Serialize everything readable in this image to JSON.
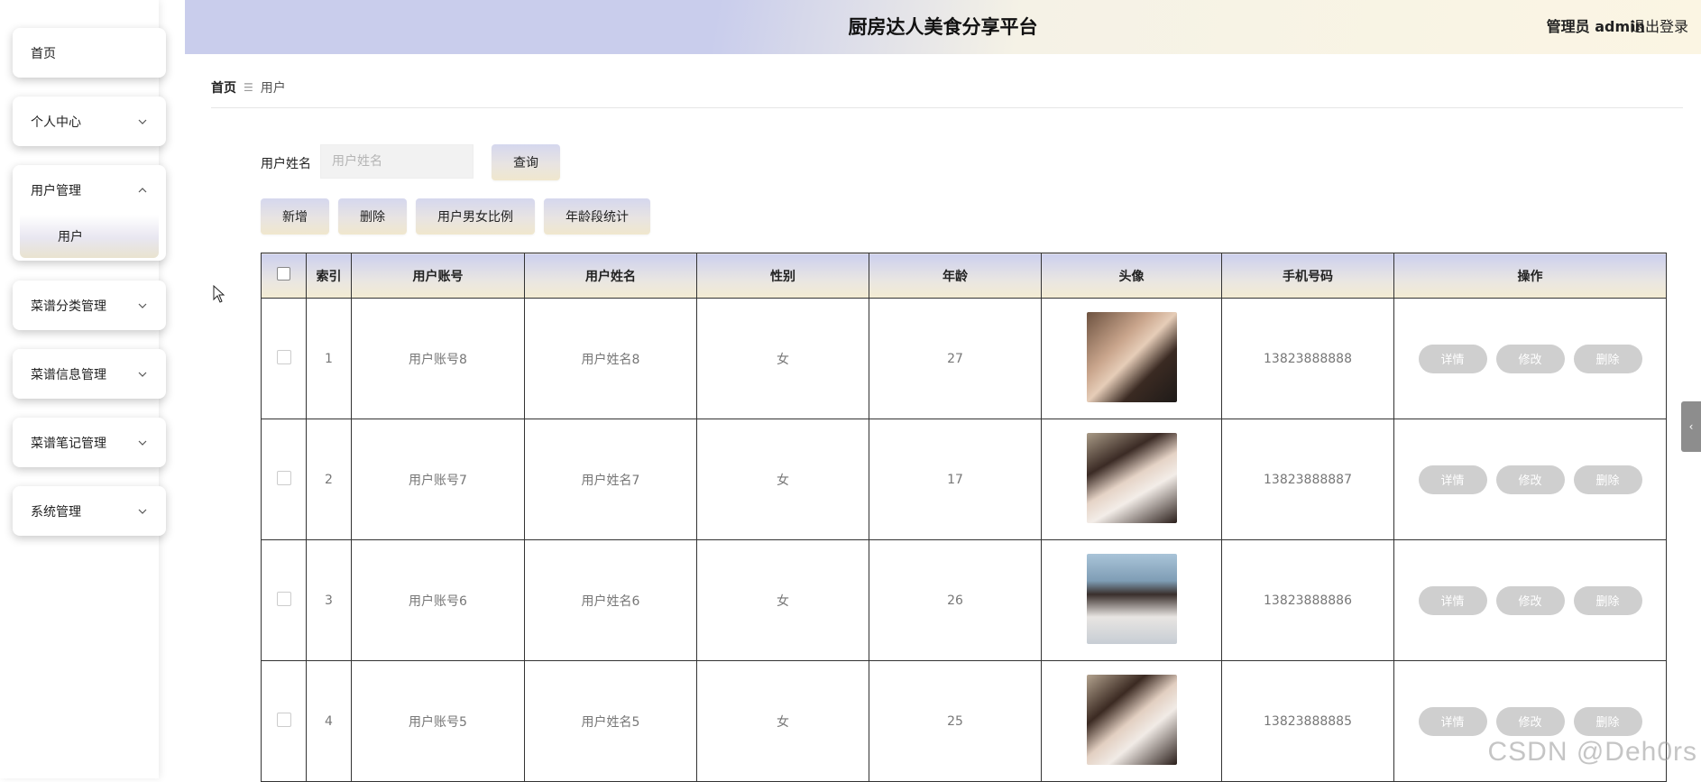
{
  "app": {
    "title": "厨房达人美食分享平台",
    "user_label": "管理员 admin",
    "logout_label": "退出登录"
  },
  "sidebar": {
    "items": [
      {
        "label": "首页",
        "icon": "none"
      },
      {
        "label": "个人中心",
        "icon": "chevron-down-icon"
      },
      {
        "label": "用户管理",
        "icon": "chevron-up-icon",
        "expanded": true,
        "children": [
          {
            "label": "用户",
            "active": true
          }
        ]
      },
      {
        "label": "菜谱分类管理",
        "icon": "chevron-down-icon"
      },
      {
        "label": "菜谱信息管理",
        "icon": "chevron-down-icon"
      },
      {
        "label": "菜谱笔记管理",
        "icon": "chevron-down-icon"
      },
      {
        "label": "系统管理",
        "icon": "chevron-down-icon"
      }
    ]
  },
  "breadcrumb": {
    "home": "首页",
    "separator": "☰",
    "current": "用户"
  },
  "search": {
    "label": "用户姓名",
    "placeholder": "用户姓名",
    "value": "",
    "button": "查询"
  },
  "actions": {
    "add": "新增",
    "delete": "删除",
    "gender_ratio": "用户男女比例",
    "age_stats": "年龄段统计"
  },
  "table": {
    "columns": [
      "索引",
      "用户账号",
      "用户姓名",
      "性别",
      "年龄",
      "头像",
      "手机号码",
      "操作"
    ],
    "rows": [
      {
        "index": "1",
        "account": "用户账号8",
        "name": "用户姓名8",
        "gender": "女",
        "age": "27",
        "phone": "13823888888"
      },
      {
        "index": "2",
        "account": "用户账号7",
        "name": "用户姓名7",
        "gender": "女",
        "age": "17",
        "phone": "13823888887"
      },
      {
        "index": "3",
        "account": "用户账号6",
        "name": "用户姓名6",
        "gender": "女",
        "age": "26",
        "phone": "13823888886"
      },
      {
        "index": "4",
        "account": "用户账号5",
        "name": "用户姓名5",
        "gender": "女",
        "age": "25",
        "phone": "13823888885"
      }
    ],
    "row_actions": {
      "detail": "详情",
      "edit": "修改",
      "delete": "删除"
    }
  },
  "watermark": "CSDN @Deh0rs",
  "colors": {
    "header_left": "#c9cdec",
    "header_right": "#fbf5e3",
    "op_button": "#cfcfcf"
  }
}
